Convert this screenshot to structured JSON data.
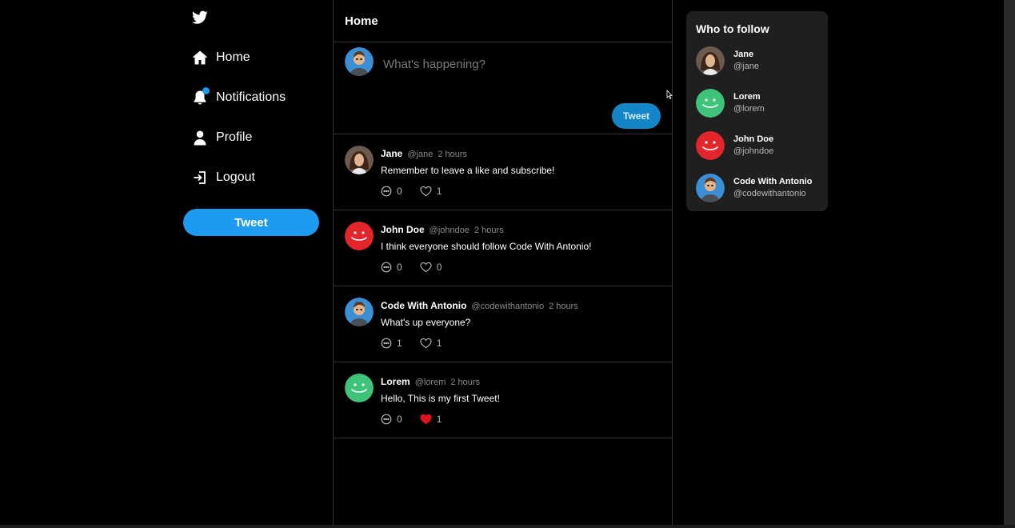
{
  "sidebar": {
    "logo": "twitter-bird-icon",
    "nav": [
      {
        "label": "Home",
        "icon": "home-icon"
      },
      {
        "label": "Notifications",
        "icon": "bell-icon",
        "has_dot": true
      },
      {
        "label": "Profile",
        "icon": "user-icon"
      },
      {
        "label": "Logout",
        "icon": "logout-icon"
      }
    ],
    "tweet_button": "Tweet"
  },
  "feed": {
    "title": "Home",
    "composer": {
      "placeholder": "What's happening?",
      "tweet_button": "Tweet"
    },
    "posts": [
      {
        "name": "Jane",
        "handle": "@jane",
        "time": "2 hours",
        "text": "Remember to leave a like and subscribe!",
        "comments": "0",
        "likes": "1",
        "liked": false,
        "avatar": "jane"
      },
      {
        "name": "John Doe",
        "handle": "@johndoe",
        "time": "2 hours",
        "text": "I think everyone should follow Code With Antonio!",
        "comments": "0",
        "likes": "0",
        "liked": false,
        "avatar": "red-smiley"
      },
      {
        "name": "Code With Antonio",
        "handle": "@codewithantonio",
        "time": "2 hours",
        "text": "What's up everyone?",
        "comments": "1",
        "likes": "1",
        "liked": false,
        "avatar": "antonio"
      },
      {
        "name": "Lorem",
        "handle": "@lorem",
        "time": "2 hours",
        "text": "Hello, This is my first Tweet!",
        "comments": "0",
        "likes": "1",
        "liked": true,
        "avatar": "green-smiley"
      }
    ]
  },
  "who_to_follow": {
    "title": "Who to follow",
    "users": [
      {
        "name": "Jane",
        "handle": "@jane",
        "avatar": "jane"
      },
      {
        "name": "Lorem",
        "handle": "@lorem",
        "avatar": "green-smiley"
      },
      {
        "name": "John Doe",
        "handle": "@johndoe",
        "avatar": "red-smiley"
      },
      {
        "name": "Code With Antonio",
        "handle": "@codewithantonio",
        "avatar": "antonio"
      }
    ]
  },
  "colors": {
    "accent": "#1d9bf0",
    "composer_button": "#1486c8",
    "card_bg": "#1f1f1f",
    "like_active": "#e0141e",
    "green_avatar": "#3fc27a",
    "red_avatar": "#e3262b"
  }
}
